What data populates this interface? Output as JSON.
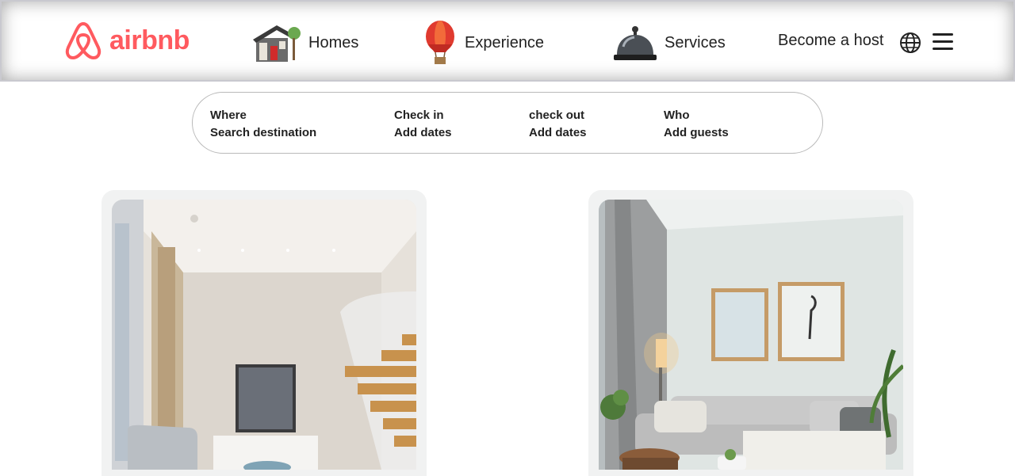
{
  "header": {
    "logo_text": "airbnb",
    "nav": [
      {
        "label": "Homes",
        "icon": "house-icon"
      },
      {
        "label": "Experience",
        "icon": "hot-air-balloon-icon"
      },
      {
        "label": "Services",
        "icon": "service-bell-icon"
      }
    ],
    "become_host": "Become a host",
    "brand_color": "#ff5a5f"
  },
  "search": {
    "where": {
      "title": "Where",
      "value": "Search destination"
    },
    "check_in": {
      "title": "Check in",
      "value": "Add dates"
    },
    "check_out": {
      "title": "check out",
      "value": "Add dates"
    },
    "who": {
      "title": "Who",
      "value": "Add guests"
    }
  },
  "listings": [
    {
      "image": "interior-with-staircase-photo"
    },
    {
      "image": "living-room-with-sofa-photo"
    }
  ]
}
